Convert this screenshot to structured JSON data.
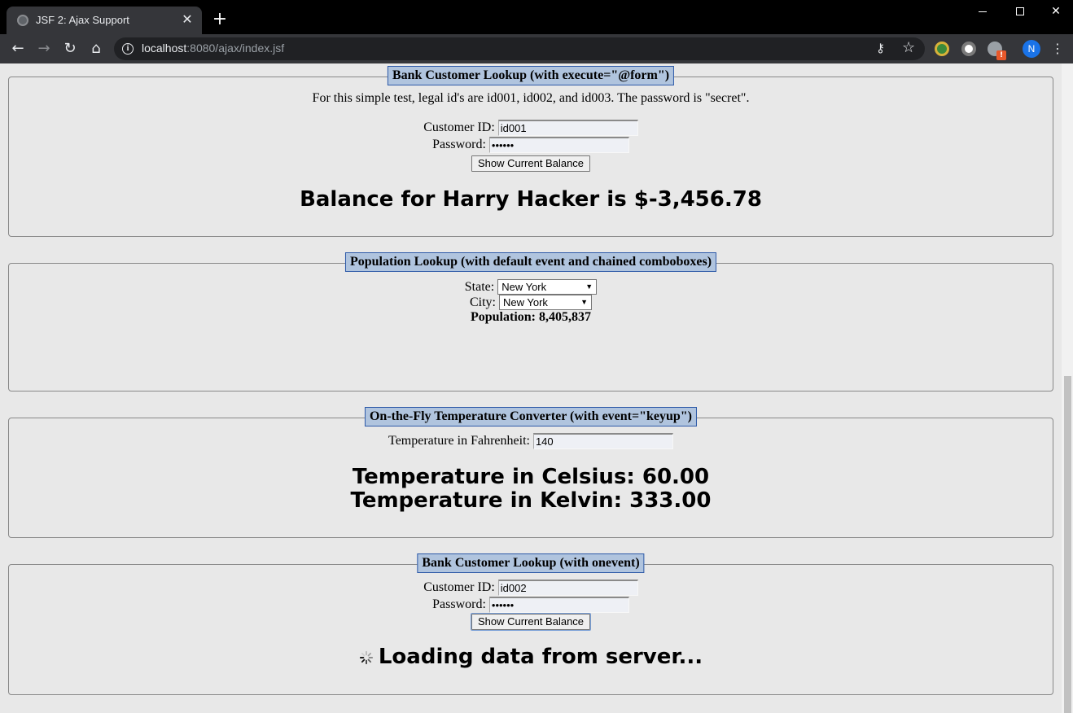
{
  "browser": {
    "tab_title": "JSF 2: Ajax Support",
    "url_host": "localhost",
    "url_rest": ":8080/ajax/index.jsf",
    "profile_initial": "N"
  },
  "panel1": {
    "legend": "Bank Customer Lookup (with execute=\"@form\")",
    "intro": "For this simple test, legal id's are id001, id002, and id003. The password is \"secret\".",
    "customer_label": "Customer ID:",
    "customer_value": "id001",
    "password_label": "Password:",
    "password_value": "••••••",
    "button_label": "Show Current Balance",
    "result": "Balance for Harry Hacker is $-3,456.78"
  },
  "panel2": {
    "legend": "Population Lookup (with default event and chained comboboxes)",
    "state_label": "State:",
    "state_value": "New York",
    "city_label": "City:",
    "city_value": "New York",
    "population": "Population: 8,405,837"
  },
  "panel3": {
    "legend": "On-the-Fly Temperature Converter (with event=\"keyup\")",
    "fahrenheit_label": "Temperature in Fahrenheit:",
    "fahrenheit_value": "140",
    "celsius": "Temperature in Celsius: 60.00",
    "kelvin": "Temperature in Kelvin: 333.00"
  },
  "panel4": {
    "legend": "Bank Customer Lookup (with onevent)",
    "customer_label": "Customer ID:",
    "customer_value": "id002",
    "password_label": "Password:",
    "password_value": "••••••",
    "button_label": "Show Current Balance",
    "loading": "Loading data from server..."
  }
}
